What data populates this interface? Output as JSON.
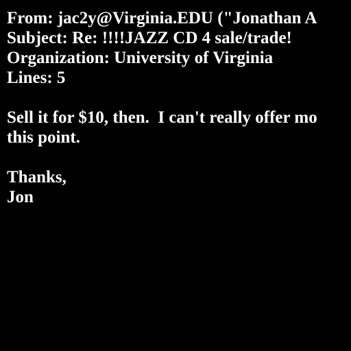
{
  "headers": {
    "from": "From: jac2y@Virginia.EDU (\"Jonathan A",
    "subject": "Subject: Re: !!!!JAZZ CD 4 sale/trade!",
    "organization": "Organization: University of Virginia",
    "lines": "Lines: 5"
  },
  "body": {
    "line1": "Sell it for $10, then.  I can't really offer mo",
    "line2": "this point.",
    "line3": "Thanks,",
    "line4": "Jon"
  },
  "colors": {
    "background": "#000000",
    "text": "#ffffff"
  }
}
